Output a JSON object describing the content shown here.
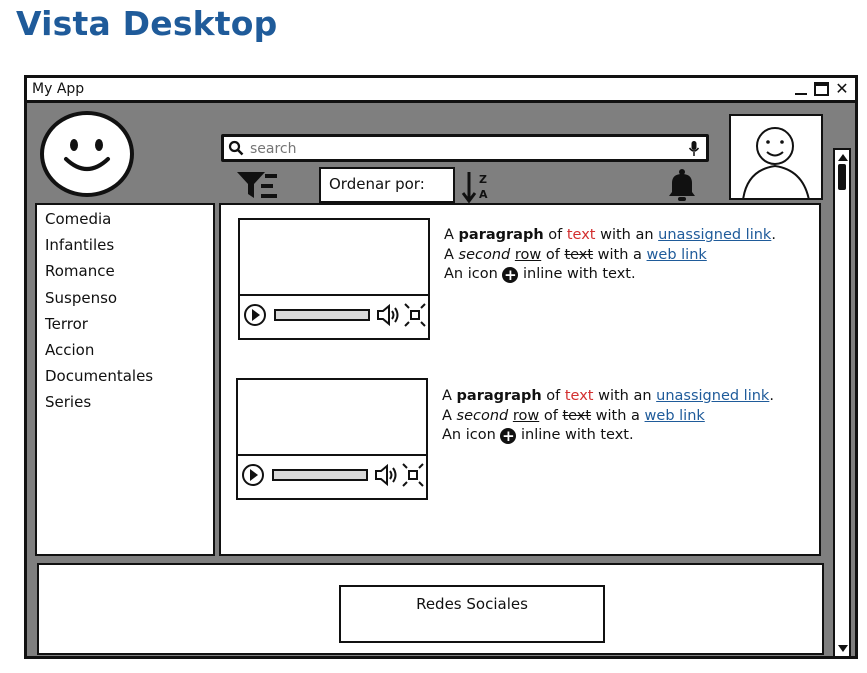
{
  "page": {
    "title": "Vista Desktop"
  },
  "window": {
    "title": "My App",
    "controls": {
      "minimize": "minimize-icon",
      "maximize": "maximize-icon",
      "close": "close-icon"
    }
  },
  "header": {
    "logo_icon": "smiley-icon",
    "search": {
      "placeholder": "search",
      "value": "",
      "icon": "search-icon",
      "mic_icon": "microphone-icon"
    },
    "filter_icon": "filter-icon",
    "order_label": "Ordenar por:",
    "sort_icon": "sort-z-a-icon",
    "bell_icon": "bell-icon",
    "avatar_icon": "user-avatar-icon"
  },
  "sidebar": {
    "items": [
      {
        "label": "Comedia"
      },
      {
        "label": "Infantiles"
      },
      {
        "label": "Romance"
      },
      {
        "label": "Suspenso"
      },
      {
        "label": "Terror"
      },
      {
        "label": "Accion"
      },
      {
        "label": "Documentales"
      },
      {
        "label": "Series"
      }
    ]
  },
  "content": {
    "cards": [
      {
        "line1": {
          "a": "A ",
          "bold": "paragraph",
          "of": " of ",
          "red": "text",
          "with": " with an ",
          "link": "unassigned link",
          "end": "."
        },
        "line2": {
          "a": "A ",
          "ital": "second",
          "sp": " ",
          "und": "row",
          "of": " of ",
          "strike": "text",
          "with": " with a ",
          "link": "web link"
        },
        "line3": {
          "a": "An icon ",
          "b": " inline with text."
        }
      },
      {
        "line1": {
          "a": "A ",
          "bold": "paragraph",
          "of": " of ",
          "red": "text",
          "with": " with an ",
          "link": "unassigned link",
          "end": "."
        },
        "line2": {
          "a": "A ",
          "ital": "second",
          "sp": " ",
          "und": "row",
          "of": " of ",
          "strike": "text",
          "with": " with a ",
          "link": "web link"
        },
        "line3": {
          "a": "An icon ",
          "b": " inline with text."
        }
      }
    ]
  },
  "footer": {
    "label": "Redes Sociales"
  },
  "colors": {
    "title": "#1f5b9a",
    "frame": "#7f7f7f",
    "link": "#1f5b9a",
    "red": "#d32f2f"
  }
}
